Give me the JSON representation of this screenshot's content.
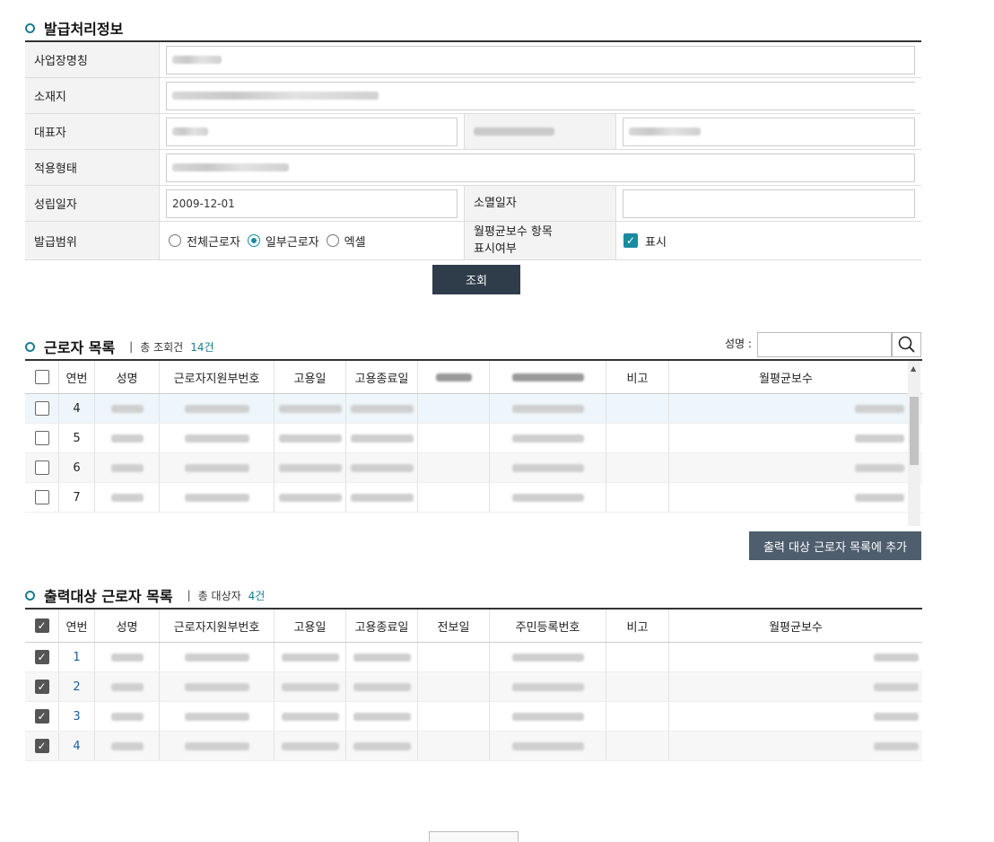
{
  "issue_section": {
    "title": "발급처리정보",
    "labels": {
      "biz_name": "사업장명칭",
      "location": "소재지",
      "representative": "대표자",
      "apply_type": "적용형태",
      "established": "성립일자",
      "extinguished": "소멸일자",
      "scope": "발급범위",
      "monthly_pay_display": "월평균보수 항목표시여부"
    },
    "established_value": "2009-12-01",
    "scope_options": [
      "전체근로자",
      "일부근로자",
      "엑셀"
    ],
    "scope_selected": "일부근로자",
    "monthly_pay_check_label": "표시",
    "monthly_pay_checked": true,
    "search_button": "조회"
  },
  "worker_list": {
    "title": "근로자 목록",
    "count_label": "총 조회건",
    "count": "14건",
    "name_search_label": "성명 :",
    "name_search_value": "",
    "columns": [
      "연번",
      "성명",
      "근로자지원부번호",
      "고용일",
      "고용종료일",
      "전보일",
      "주민등록번호",
      "비고",
      "월평균보수"
    ],
    "rows": [
      {
        "no": "4",
        "checked": false
      },
      {
        "no": "5",
        "checked": false
      },
      {
        "no": "6",
        "checked": false
      },
      {
        "no": "7",
        "checked": false
      }
    ],
    "add_button": "출력 대상 근로자 목록에 추가"
  },
  "output_list": {
    "title": "출력대상 근로자 목록",
    "count_label": "총 대상자",
    "count": "4건",
    "columns": [
      "연번",
      "성명",
      "근로자지원부번호",
      "고용일",
      "고용종료일",
      "전보일",
      "주민등록번호",
      "비고",
      "월평균보수"
    ],
    "rows": [
      {
        "no": "1",
        "checked": true
      },
      {
        "no": "2",
        "checked": true
      },
      {
        "no": "3",
        "checked": true
      },
      {
        "no": "4",
        "checked": true
      }
    ]
  },
  "colors": {
    "accent": "#1a7d8f",
    "button_dark": "#2f3c4a",
    "add_button": "#4e5e6e"
  }
}
